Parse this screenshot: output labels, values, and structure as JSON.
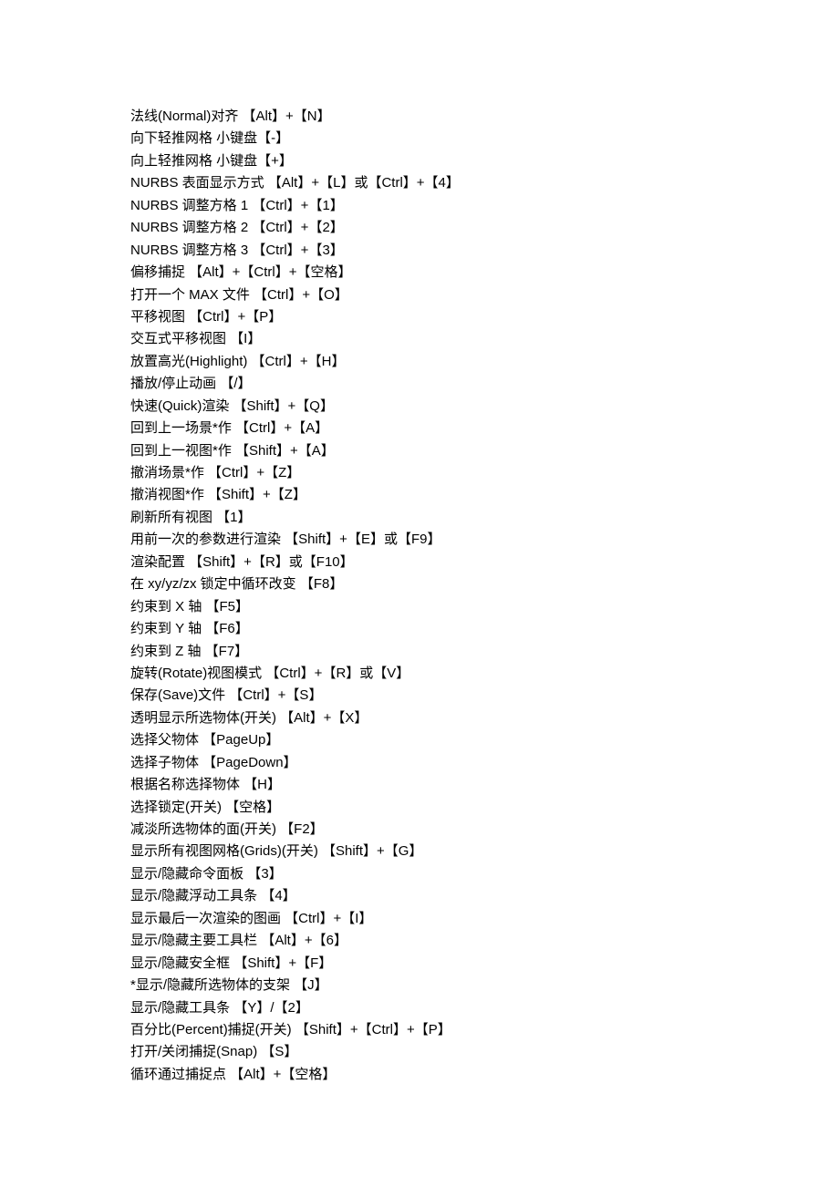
{
  "shortcuts": [
    {
      "text": "法线(Normal)对齐 【Alt】+【N】"
    },
    {
      "text": "向下轻推网格 小键盘【-】"
    },
    {
      "text": "向上轻推网格 小键盘【+】"
    },
    {
      "text": "NURBS 表面显示方式 【Alt】+【L】或【Ctrl】+【4】"
    },
    {
      "text": "NURBS 调整方格 1 【Ctrl】+【1】"
    },
    {
      "text": "NURBS 调整方格 2 【Ctrl】+【2】"
    },
    {
      "text": "NURBS 调整方格 3 【Ctrl】+【3】"
    },
    {
      "text": "偏移捕捉 【Alt】+【Ctrl】+【空格】"
    },
    {
      "text": "打开一个 MAX 文件 【Ctrl】+【O】"
    },
    {
      "text": "平移视图 【Ctrl】+【P】"
    },
    {
      "text": "交互式平移视图 【I】"
    },
    {
      "text": "放置高光(Highlight) 【Ctrl】+【H】"
    },
    {
      "text": "播放/停止动画 【/】"
    },
    {
      "text": "快速(Quick)渲染 【Shift】+【Q】"
    },
    {
      "text": "回到上一场景*作 【Ctrl】+【A】"
    },
    {
      "text": "回到上一视图*作 【Shift】+【A】"
    },
    {
      "text": "撤消场景*作 【Ctrl】+【Z】"
    },
    {
      "text": "撤消视图*作 【Shift】+【Z】"
    },
    {
      "text": "刷新所有视图 【1】"
    },
    {
      "text": "用前一次的参数进行渲染 【Shift】+【E】或【F9】"
    },
    {
      "text": "渲染配置 【Shift】+【R】或【F10】"
    },
    {
      "text": "在 xy/yz/zx 锁定中循环改变 【F8】"
    },
    {
      "text": "约束到 X 轴 【F5】"
    },
    {
      "text": "约束到 Y 轴 【F6】"
    },
    {
      "text": "约束到 Z 轴 【F7】"
    },
    {
      "text": "旋转(Rotate)视图模式 【Ctrl】+【R】或【V】"
    },
    {
      "text": "保存(Save)文件 【Ctrl】+【S】"
    },
    {
      "text": "透明显示所选物体(开关) 【Alt】+【X】"
    },
    {
      "text": "选择父物体 【PageUp】"
    },
    {
      "text": "选择子物体 【PageDown】"
    },
    {
      "text": "根据名称选择物体 【H】"
    },
    {
      "text": "选择锁定(开关) 【空格】"
    },
    {
      "text": "减淡所选物体的面(开关) 【F2】"
    },
    {
      "text": "显示所有视图网格(Grids)(开关) 【Shift】+【G】"
    },
    {
      "text": "显示/隐藏命令面板 【3】"
    },
    {
      "text": "显示/隐藏浮动工具条 【4】"
    },
    {
      "text": "显示最后一次渲染的图画 【Ctrl】+【I】"
    },
    {
      "text": "显示/隐藏主要工具栏 【Alt】+【6】"
    },
    {
      "text": "显示/隐藏安全框 【Shift】+【F】"
    },
    {
      "text": "*显示/隐藏所选物体的支架 【J】"
    },
    {
      "text": "显示/隐藏工具条 【Y】/【2】"
    },
    {
      "text": "百分比(Percent)捕捉(开关) 【Shift】+【Ctrl】+【P】"
    },
    {
      "text": "打开/关闭捕捉(Snap) 【S】"
    },
    {
      "text": "循环通过捕捉点 【Alt】+【空格】"
    }
  ]
}
